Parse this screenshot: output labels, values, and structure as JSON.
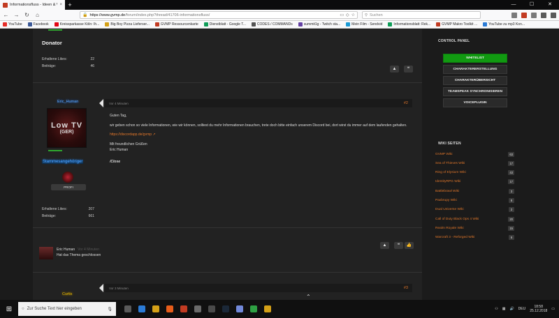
{
  "browser": {
    "tab_title": "Informationsfluss - Ideen & Wü",
    "tab_close": "×",
    "new_tab": "+",
    "win_min": "—",
    "win_max": "☐",
    "win_close": "✕",
    "url_host": "https://www.gvmp.de",
    "url_path": "/forum/index.php?thread/41706-informationsfluss/",
    "search_placeholder": "Suchen",
    "bookmarks": [
      {
        "label": "YouTube",
        "color": "#e52d27"
      },
      {
        "label": "Facebook",
        "color": "#3b5998"
      },
      {
        "label": "Kreissparkasse Köln: Ih...",
        "color": "#e30613"
      },
      {
        "label": "Big Boy Pizza Lieferser...",
        "color": "#d4a017"
      },
      {
        "label": "GVMP Ressourcenkarte",
        "color": "#c23b22"
      },
      {
        "label": "Dienstblatt - Google T...",
        "color": "#0f9d58"
      },
      {
        "label": "CODES / COMMANDs",
        "color": "#555555"
      },
      {
        "label": "summit1g - Twitch sta...",
        "color": "#6441a4"
      },
      {
        "label": "Mein Film - Sendvid",
        "color": "#1b9bd6"
      },
      {
        "label": "Informationsblatt: Rek...",
        "color": "#0f9d58"
      },
      {
        "label": "GVMP Makro Toolkit ...",
        "color": "#c23b22"
      },
      {
        "label": "YouTube zu mp3 Kon...",
        "color": "#2b7bd6"
      }
    ]
  },
  "donator_card": {
    "title": "Donator",
    "likes_label": "Erhaltene Likes:",
    "likes_value": "22",
    "posts_label": "Beiträge:",
    "posts_value": "46"
  },
  "post": {
    "author": "Eric_Human",
    "avatar_line1": "Low TV",
    "avatar_line2": "(GER)",
    "rank_title": "Stammesangehöriger",
    "rank_pill": "PROFI",
    "likes_label": "Erhaltene Likes:",
    "likes_value": "207",
    "posts_label": "Beiträge:",
    "posts_value": "661",
    "time": "Vor 4 Minuten",
    "number": "#2",
    "greeting": "Guten Tag,",
    "body": "wir geben schon so viele Informationen, wie wir können, solltest du mehr Informationen brauchen, trete doch bitte einfach unserem Discord bei, dort wirst du immer auf dem laufenden gehalten.",
    "link": "https://discordapp.de/gvmp",
    "sign1": "Mit freundlichen Grüßen",
    "sign2": "Eric Human",
    "close": "/Close"
  },
  "system_msg": {
    "name": "Eric Human",
    "time": "Vor 4 Minuten",
    "text": "Hat das Thema geschlossen"
  },
  "post2": {
    "author": "Curtis",
    "time": "Vor 3 Minuten",
    "number": "#3"
  },
  "icons": {
    "report": "▲",
    "quote": "❝",
    "like": "👍",
    "scroll_up": "⌃"
  },
  "control_panel": {
    "title": "CONTROL PANEL",
    "buttons": [
      "WHITELIST",
      "CHARAKTERERSTELLUNG",
      "CHARAKTERÜBERSICHT",
      "TEAMSPEAK SYNCHRONISIEREN",
      "VOICEPLUGIN"
    ]
  },
  "wiki": {
    "title": "WIKI SEITEN",
    "items": [
      {
        "label": "GVMP Wiki",
        "count": "63"
      },
      {
        "label": "Sea of Thieves Wiki",
        "count": "17"
      },
      {
        "label": "Ring of Elysium Wiki",
        "count": "43"
      },
      {
        "label": "IdentityRPG Wiki",
        "count": "17"
      },
      {
        "label": "Battlebrawl Wiki",
        "count": "3"
      },
      {
        "label": "Paxbrupy Wiki",
        "count": "8"
      },
      {
        "label": "Dual Universe Wiki",
        "count": "2"
      },
      {
        "label": "Call of Duty Black Ops 4 Wiki",
        "count": "20"
      },
      {
        "label": "Realm Royale Wiki",
        "count": "15"
      },
      {
        "label": "Warcraft 3 - Reforged Wiki",
        "count": "6"
      }
    ]
  },
  "taskbar": {
    "search_placeholder": "Zur Suche Text hier eingeben",
    "lang": "DEU",
    "time": "18:58",
    "date": "25.12.2018"
  },
  "colors": {
    "accent_orange": "#e0762a",
    "active_green": "#119a11"
  }
}
